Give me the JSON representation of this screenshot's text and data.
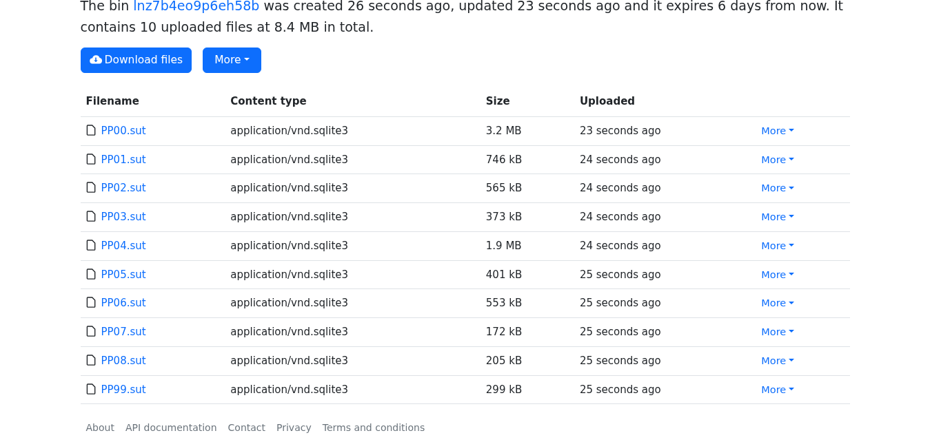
{
  "intro": {
    "before": "The bin",
    "bin_link": "lnz7b4eo9p6eh58b",
    "after": "was created 26 seconds ago, updated 23 seconds ago and it expires 6 days from now. It contains 10 uploaded files at 8.4 MB in total."
  },
  "actions": [
    {
      "kind": "download",
      "label": "Download files"
    },
    {
      "kind": "dropdown",
      "label": "More"
    }
  ],
  "table": {
    "columns": [
      "Filename",
      "Content type",
      "Size",
      "Uploaded"
    ],
    "rows": [
      {
        "filename": "PP00.sut",
        "content_type": "application/vnd.sqlite3",
        "size": "3.2 MB",
        "uploaded": "23 seconds ago",
        "action": "More"
      },
      {
        "filename": "PP01.sut",
        "content_type": "application/vnd.sqlite3",
        "size": "746 kB",
        "uploaded": "24 seconds ago",
        "action": "More"
      },
      {
        "filename": "PP02.sut",
        "content_type": "application/vnd.sqlite3",
        "size": "565 kB",
        "uploaded": "24 seconds ago",
        "action": "More"
      },
      {
        "filename": "PP03.sut",
        "content_type": "application/vnd.sqlite3",
        "size": "373 kB",
        "uploaded": "24 seconds ago",
        "action": "More"
      },
      {
        "filename": "PP04.sut",
        "content_type": "application/vnd.sqlite3",
        "size": "1.9 MB",
        "uploaded": "24 seconds ago",
        "action": "More"
      },
      {
        "filename": "PP05.sut",
        "content_type": "application/vnd.sqlite3",
        "size": "401 kB",
        "uploaded": "25 seconds ago",
        "action": "More"
      },
      {
        "filename": "PP06.sut",
        "content_type": "application/vnd.sqlite3",
        "size": "553 kB",
        "uploaded": "25 seconds ago",
        "action": "More"
      },
      {
        "filename": "PP07.sut",
        "content_type": "application/vnd.sqlite3",
        "size": "172 kB",
        "uploaded": "25 seconds ago",
        "action": "More"
      },
      {
        "filename": "PP08.sut",
        "content_type": "application/vnd.sqlite3",
        "size": "205 kB",
        "uploaded": "25 seconds ago",
        "action": "More"
      },
      {
        "filename": "PP99.sut",
        "content_type": "application/vnd.sqlite3",
        "size": "299 kB",
        "uploaded": "25 seconds ago",
        "action": "More"
      }
    ]
  },
  "footer_links": [
    "About",
    "API documentation",
    "Contact",
    "Privacy",
    "Terms and conditions"
  ]
}
